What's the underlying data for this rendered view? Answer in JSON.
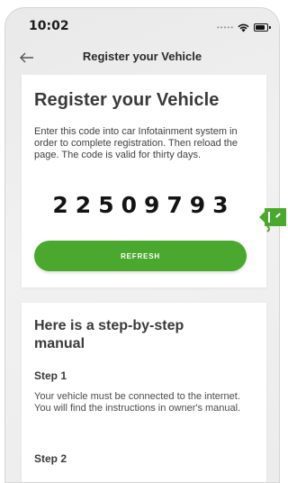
{
  "status_bar": {
    "time": "10:02"
  },
  "nav": {
    "title": "Register your Vehicle",
    "back_icon": "arrow-left-icon"
  },
  "register_card": {
    "title": "Register your Vehicle",
    "description": "Enter this code into car Infotainment system in order to complete registration. Then reload the page. The code is valid for thirty days.",
    "code": "22509793",
    "refresh_label": "REFRESH"
  },
  "manual_card": {
    "title": "Here is a step-by-step manual",
    "steps": [
      {
        "heading": "Step 1",
        "text": "Your vehicle must be connected to the internet. You will find the instructions in owner's manual."
      },
      {
        "heading": "Step 2"
      }
    ]
  },
  "colors": {
    "accent": "#4ba82e",
    "background": "#ececec",
    "card": "#ffffff",
    "text": "#3a3a3a"
  }
}
